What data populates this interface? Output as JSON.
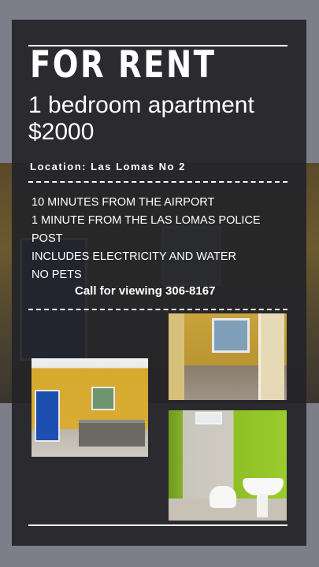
{
  "headline": "FOR RENT",
  "subhead_line1": "1 bedroom apartment",
  "subhead_line2": "$2000",
  "location": "Location: Las Lomas No 2",
  "features": [
    "10 MINUTES FROM THE AIRPORT",
    "1 MINUTE FROM THE LAS LOMAS POLICE POST",
    "INCLUDES ELECTRICITY AND WATER",
    "NO PETS"
  ],
  "call_to_action": "Call for viewing 306-8167",
  "photos": [
    "photo-hallway",
    "photo-kitchen",
    "photo-bathroom"
  ]
}
